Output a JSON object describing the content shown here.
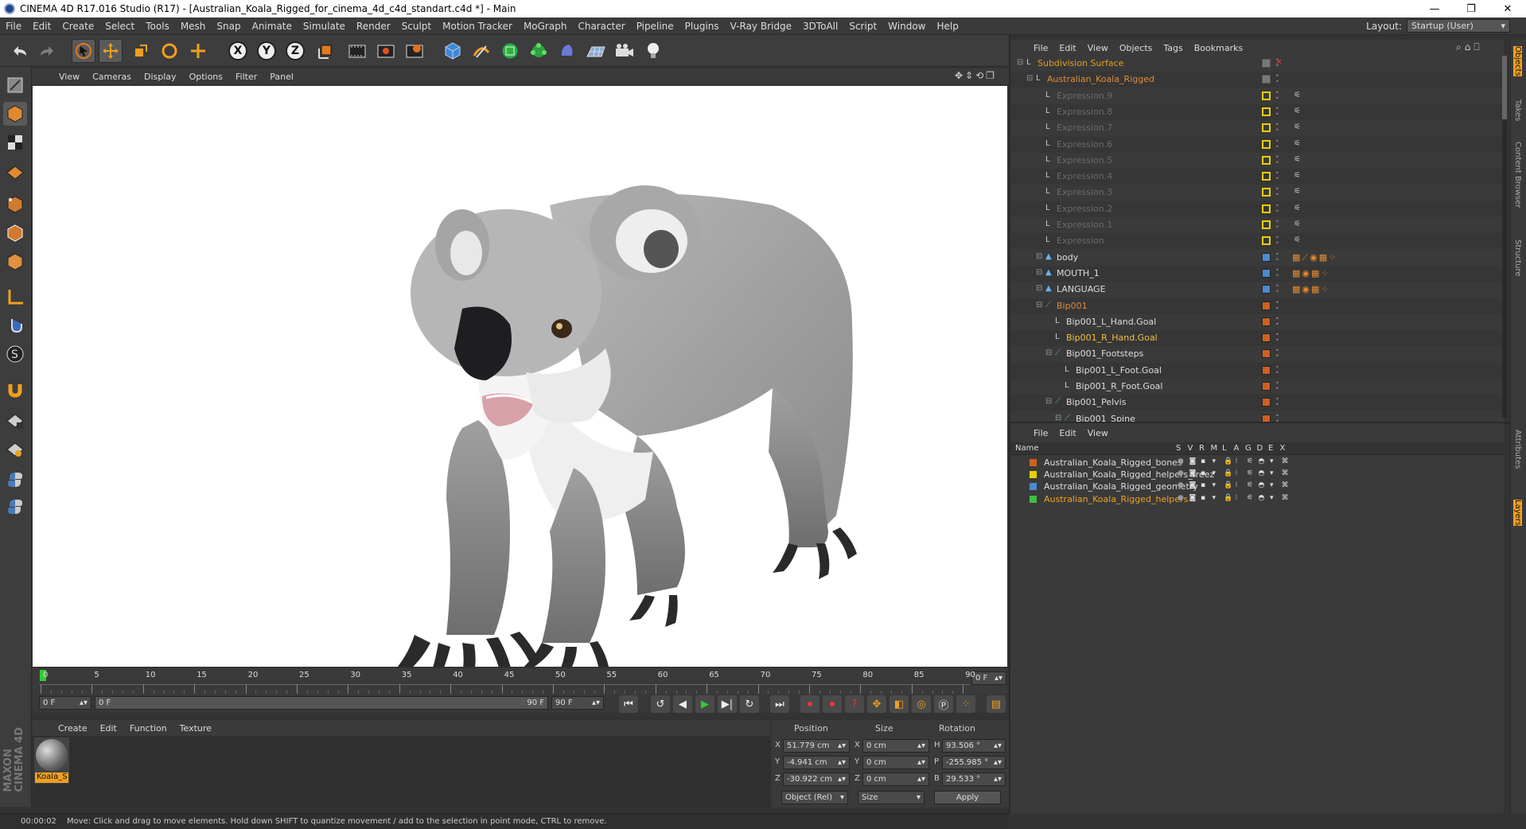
{
  "window": {
    "title": "CINEMA 4D R17.016 Studio (R17) - [Australian_Koala_Rigged_for_cinema_4d_c4d_standart.c4d *] - Main"
  },
  "menu": [
    "File",
    "Edit",
    "Create",
    "Select",
    "Tools",
    "Mesh",
    "Snap",
    "Animate",
    "Simulate",
    "Render",
    "Sculpt",
    "Motion Tracker",
    "MoGraph",
    "Character",
    "Pipeline",
    "Plugins",
    "V-Ray Bridge",
    "3DToAll",
    "Script",
    "Window",
    "Help"
  ],
  "layout": {
    "label": "Layout:",
    "value": "Startup (User)"
  },
  "toolbar": {
    "x": "X",
    "y": "Y",
    "z": "Z"
  },
  "viewport_menu": [
    "View",
    "Cameras",
    "Display",
    "Options",
    "Filter",
    "Panel"
  ],
  "timeline": {
    "ticks": [
      "0",
      "5",
      "10",
      "15",
      "20",
      "25",
      "30",
      "35",
      "40",
      "45",
      "50",
      "55",
      "60",
      "65",
      "70",
      "75",
      "80",
      "85",
      "90"
    ],
    "current_frame": "0 F",
    "start": "0 F",
    "range_start": "0 F",
    "range_end": "90 F",
    "end": "90 F"
  },
  "material_menu": [
    "Create",
    "Edit",
    "Function",
    "Texture"
  ],
  "material": {
    "name": "Koala_S"
  },
  "coords": {
    "headers": [
      "Position",
      "Size",
      "Rotation"
    ],
    "rows": [
      {
        "axis": "X",
        "pos": "51.779 cm",
        "size_axis": "X",
        "size": "0 cm",
        "rot_axis": "H",
        "rot": "93.506 °"
      },
      {
        "axis": "Y",
        "pos": "-4.941 cm",
        "size_axis": "Y",
        "size": "0 cm",
        "rot_axis": "P",
        "rot": "-255.985 °"
      },
      {
        "axis": "Z",
        "pos": "-30.922 cm",
        "size_axis": "Z",
        "size": "0 cm",
        "rot_axis": "B",
        "rot": "29.533 °"
      }
    ],
    "mode": "Object (Rel)",
    "size_mode": "Size",
    "apply": "Apply"
  },
  "status": {
    "time": "00:00:02",
    "message": "Move: Click and drag to move elements. Hold down SHIFT to quantize movement / add to the selection in point mode, CTRL to remove."
  },
  "objects_menu": [
    "File",
    "Edit",
    "View",
    "Objects",
    "Tags",
    "Bookmarks"
  ],
  "objects": [
    {
      "name": "Subdivision Surface",
      "indent": 0,
      "color": "#e0a020",
      "vis": "none"
    },
    {
      "name": "Australian_Koala_Rigged",
      "indent": 1,
      "color": "#e08a3a",
      "vis": "none"
    },
    {
      "name": "Expression.9",
      "indent": 2,
      "color": "#6a6a6a",
      "vis": "#e8d000"
    },
    {
      "name": "Expression.8",
      "indent": 2,
      "color": "#6a6a6a",
      "vis": "#e8d000"
    },
    {
      "name": "Expression.7",
      "indent": 2,
      "color": "#6a6a6a",
      "vis": "#e8d000"
    },
    {
      "name": "Expression.6",
      "indent": 2,
      "color": "#6a6a6a",
      "vis": "#e8d000"
    },
    {
      "name": "Expression.5",
      "indent": 2,
      "color": "#6a6a6a",
      "vis": "#e8d000"
    },
    {
      "name": "Expression.4",
      "indent": 2,
      "color": "#6a6a6a",
      "vis": "#e8d000"
    },
    {
      "name": "Expression.3",
      "indent": 2,
      "color": "#6a6a6a",
      "vis": "#e8d000"
    },
    {
      "name": "Expression.2",
      "indent": 2,
      "color": "#6a6a6a",
      "vis": "#e8d000"
    },
    {
      "name": "Expression.1",
      "indent": 2,
      "color": "#6a6a6a",
      "vis": "#e8d000"
    },
    {
      "name": "Expression",
      "indent": 2,
      "color": "#6a6a6a",
      "vis": "#e8d000"
    },
    {
      "name": "body",
      "indent": 2,
      "color": "#dddddd",
      "vis": "#4a8ad0"
    },
    {
      "name": "MOUTH_1",
      "indent": 2,
      "color": "#dddddd",
      "vis": "#4a8ad0"
    },
    {
      "name": "LANGUAGE",
      "indent": 2,
      "color": "#dddddd",
      "vis": "#4a8ad0"
    },
    {
      "name": "Bip001",
      "indent": 2,
      "color": "#e08a3a",
      "vis": "#d06020"
    },
    {
      "name": "Bip001_L_Hand.Goal",
      "indent": 3,
      "color": "#dddddd",
      "vis": "#d06020"
    },
    {
      "name": "Bip001_R_Hand.Goal",
      "indent": 3,
      "color": "#f0c040",
      "vis": "#d06020"
    },
    {
      "name": "Bip001_Footsteps",
      "indent": 3,
      "color": "#dddddd",
      "vis": "#d06020"
    },
    {
      "name": "Bip001_L_Foot.Goal",
      "indent": 4,
      "color": "#dddddd",
      "vis": "#d06020"
    },
    {
      "name": "Bip001_R_Foot.Goal",
      "indent": 4,
      "color": "#dddddd",
      "vis": "#d06020"
    },
    {
      "name": "Bip001_Pelvis",
      "indent": 3,
      "color": "#dddddd",
      "vis": "#d06020"
    },
    {
      "name": "Bip001_Spine",
      "indent": 4,
      "color": "#dddddd",
      "vis": "#d06020"
    }
  ],
  "layers_menu": [
    "File",
    "Edit",
    "View"
  ],
  "layers_header": {
    "name": "Name",
    "cols": [
      "S",
      "V",
      "R",
      "M",
      "L",
      "A",
      "G",
      "D",
      "E",
      "X"
    ]
  },
  "layers": [
    {
      "name": "Australian_Koala_Rigged_bones",
      "color": "#d06020",
      "text": "#dddddd"
    },
    {
      "name": "Australian_Koala_Rigged_helpers_freez",
      "color": "#e8d000",
      "text": "#dddddd"
    },
    {
      "name": "Australian_Koala_Rigged_geometry",
      "color": "#4a8ad0",
      "text": "#dddddd"
    },
    {
      "name": "Australian_Koala_Rigged_helpers",
      "color": "#40c040",
      "text": "#f0a020"
    }
  ],
  "right_tabs": {
    "top": [
      "Objects",
      "Takes",
      "Content Browser",
      "Structure"
    ],
    "bottom": [
      "Attributes",
      "Layers"
    ]
  }
}
